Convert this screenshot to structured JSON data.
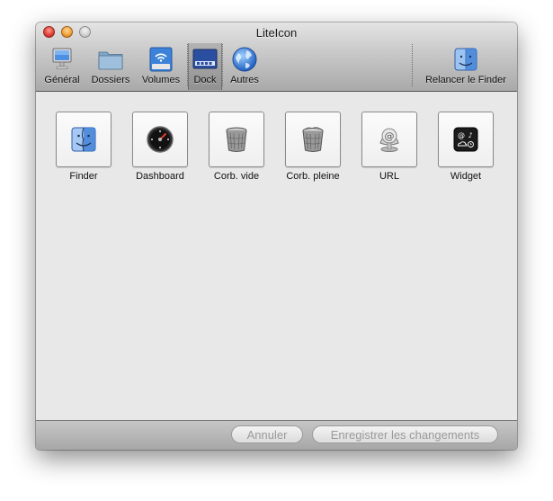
{
  "window": {
    "title": "LiteIcon"
  },
  "toolbar": {
    "items": [
      {
        "label": "Général",
        "icon": "monitor-icon",
        "selected": false
      },
      {
        "label": "Dossiers",
        "icon": "folder-icon",
        "selected": false
      },
      {
        "label": "Volumes",
        "icon": "external-drive-icon",
        "selected": false
      },
      {
        "label": "Dock",
        "icon": "dock-icon",
        "selected": true
      },
      {
        "label": "Autres",
        "icon": "globe-icon",
        "selected": false
      }
    ],
    "relaunch": {
      "label": "Relancer le Finder",
      "icon": "finder-icon"
    }
  },
  "icons": [
    {
      "label": "Finder",
      "icon": "finder-icon"
    },
    {
      "label": "Dashboard",
      "icon": "dashboard-icon"
    },
    {
      "label": "Corb. vide",
      "icon": "trash-empty-icon"
    },
    {
      "label": "Corb. pleine",
      "icon": "trash-full-icon"
    },
    {
      "label": "URL",
      "icon": "url-icon"
    },
    {
      "label": "Widget",
      "icon": "widget-icon"
    }
  ],
  "footer": {
    "cancel_label": "Annuler",
    "save_label": "Enregistrer les changements"
  }
}
